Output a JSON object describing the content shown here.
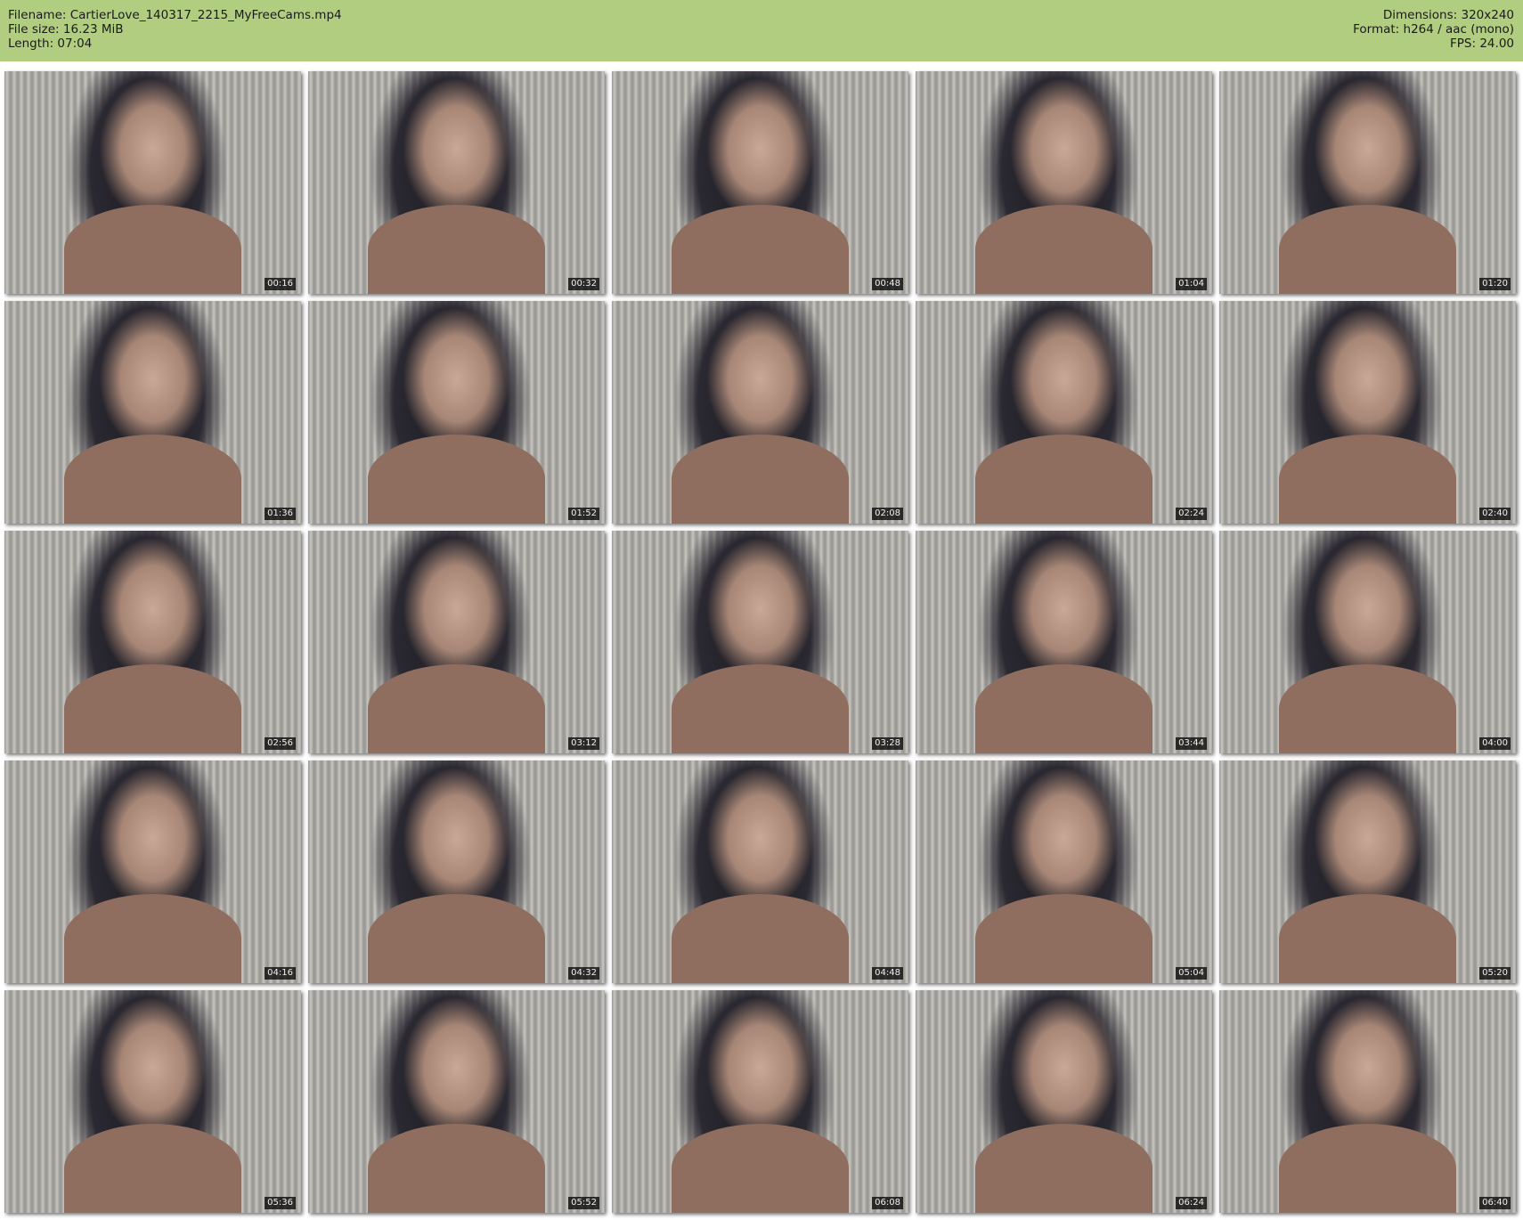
{
  "header": {
    "filename": "Filename: CartierLove_140317_2215_MyFreeCams.mp4",
    "file_size": "File size: 16.23 MiB",
    "length": "Length: 07:04",
    "dimensions": "Dimensions: 320x240",
    "format": "Format: h264 / aac (mono)",
    "fps": "FPS: 24.00"
  },
  "colors": {
    "header_bg": "#b1cd7f"
  },
  "thumbnails": [
    "00:16",
    "00:32",
    "00:48",
    "01:04",
    "01:20",
    "01:36",
    "01:52",
    "02:08",
    "02:24",
    "02:40",
    "02:56",
    "03:12",
    "03:28",
    "03:44",
    "04:00",
    "04:16",
    "04:32",
    "04:48",
    "05:04",
    "05:20",
    "05:36",
    "05:52",
    "06:08",
    "06:24",
    "06:40"
  ]
}
